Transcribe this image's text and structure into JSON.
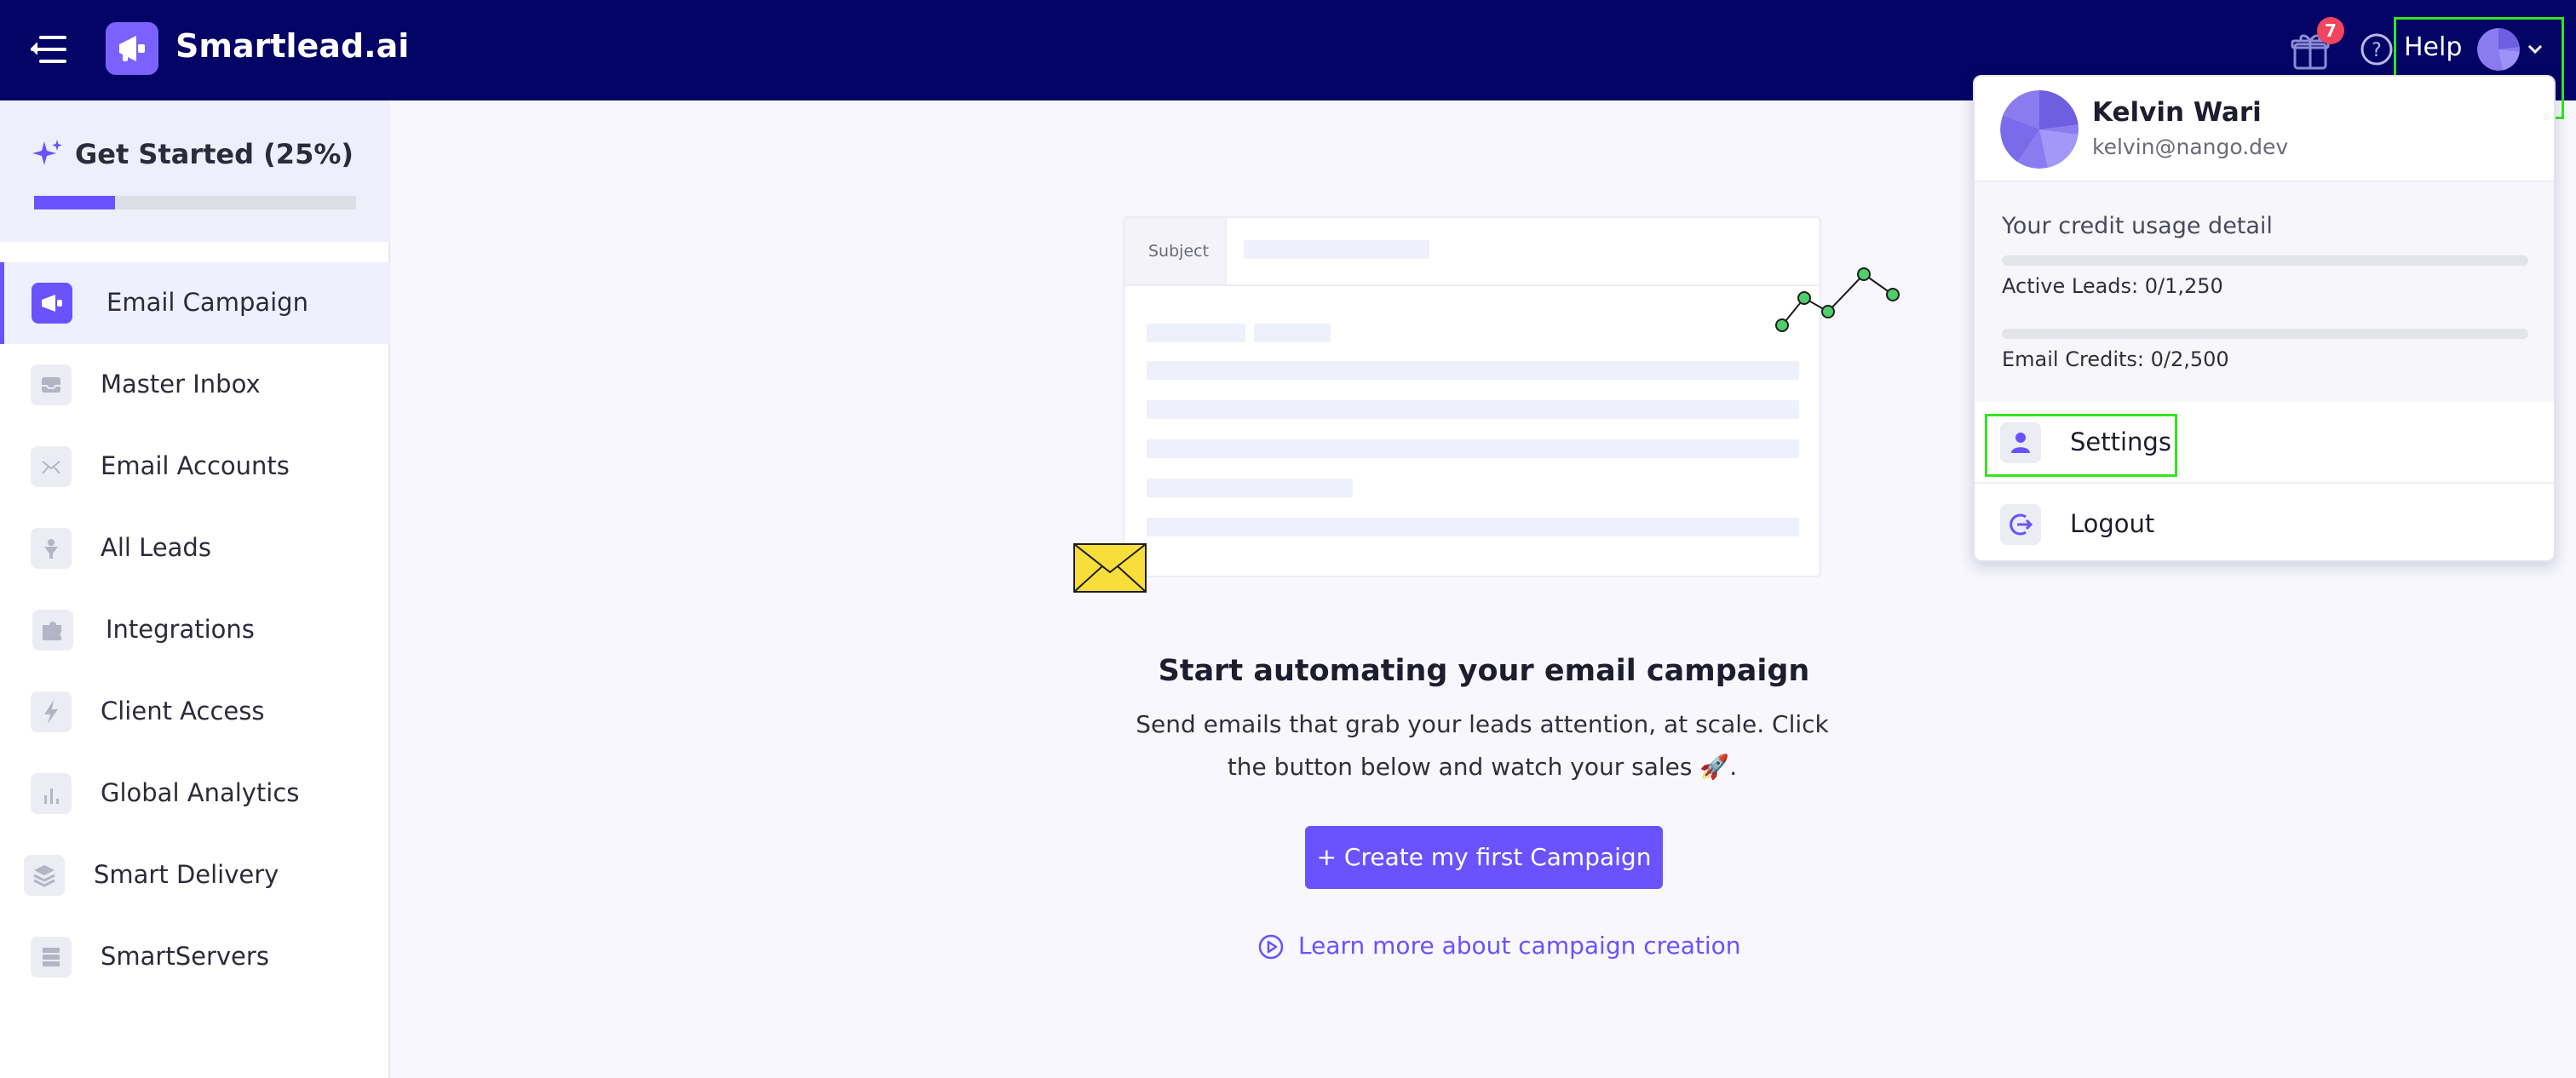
{
  "header": {
    "brand": "Smartlead.ai",
    "gift_badge_count": "7",
    "help_label": "Help"
  },
  "sidebar": {
    "get_started": {
      "title": "Get Started (25%)",
      "progress": 0.25
    },
    "items": [
      {
        "label": "Email Campaign",
        "icon": "megaphone-icon",
        "active": true
      },
      {
        "label": "Master Inbox",
        "icon": "inbox-icon",
        "active": false
      },
      {
        "label": "Email Accounts",
        "icon": "mail-icon",
        "active": false
      },
      {
        "label": "All Leads",
        "icon": "funnel-icon",
        "active": false
      },
      {
        "label": "Integrations",
        "icon": "puzzle-icon",
        "active": false
      },
      {
        "label": "Client Access",
        "icon": "lightning-icon",
        "active": false
      },
      {
        "label": "Global Analytics",
        "icon": "bar-chart-icon",
        "active": false
      },
      {
        "label": "Smart Delivery",
        "icon": "layers-icon",
        "active": false
      },
      {
        "label": "SmartServers",
        "icon": "server-icon",
        "active": false
      }
    ]
  },
  "main": {
    "illustration": {
      "subject_label": "Subject"
    },
    "title": "Start automating your email campaign",
    "description": "Send emails that grab your leads attention, at scale. Click the button below and watch your sales 🚀.",
    "create_button": "+ Create my first Campaign",
    "learn_link": "Learn more about campaign creation"
  },
  "user_menu": {
    "name": "Kelvin Wari",
    "email": "kelvin@nango.dev",
    "credit_title": "Your credit usage detail",
    "active_leads": "Active Leads: 0/1,250",
    "active_leads_usage": 0,
    "email_credits": "Email Credits: 0/2,500",
    "email_credits_usage": 0,
    "settings_label": "Settings",
    "logout_label": "Logout"
  },
  "colors": {
    "topbar": "#030465",
    "accent": "#6a52ff",
    "highlight": "#33e51f",
    "badge": "#f0445f"
  }
}
